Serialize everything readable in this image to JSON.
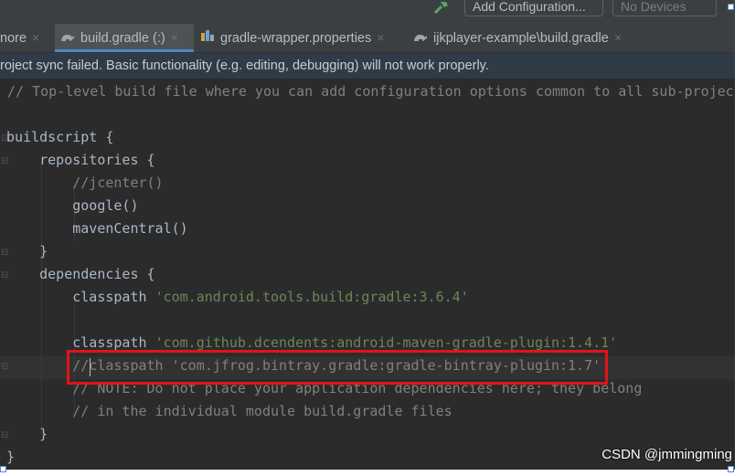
{
  "toolbar": {
    "config_label": "Add Configuration...",
    "devices_label": "No Devices"
  },
  "tabs": [
    {
      "label": "nore",
      "close": "×",
      "active": false
    },
    {
      "label": "build.gradle (:)",
      "close": "×",
      "active": true,
      "icon": "gradle-icon"
    },
    {
      "label": "gradle-wrapper.properties",
      "close": "×",
      "active": false,
      "icon": "properties-icon"
    },
    {
      "label": "ijkplayer-example\\build.gradle",
      "close": "×",
      "active": false,
      "icon": "gradle-icon"
    }
  ],
  "banner": {
    "message": "roject sync failed. Basic functionality (e.g. editing, debugging) will not work properly."
  },
  "code": {
    "line1": "// Top-level build file where you can add configuration options common to all sub-projec",
    "line3": "buildscript {",
    "line4": "    repositories {",
    "line5": "        //jcenter()",
    "line6": "        google()",
    "line7": "        mavenCentral()",
    "line8": "    }",
    "line9": "    dependencies {",
    "line10_kw": "        classpath ",
    "line10_str": "'com.android.tools.build:gradle:3.6.4'",
    "line12_kw": "        classpath ",
    "line12_str": "'com.github.dcendents:android-maven-gradle-plugin:1.4.1'",
    "line13": "        //classpath 'com.jfrog.bintray.gradle:gradle-bintray-plugin:1.7'",
    "line14": "        // NOTE: Do not place your application dependencies here; they belong",
    "line15": "        // in the individual module build.gradle files",
    "line16": "    }",
    "line17": "}"
  },
  "watermark": "CSDN @jmmingming",
  "colors": {
    "editor_bg": "#2b2b2b",
    "comment": "#808080",
    "string": "#6a8759",
    "highlight_box": "#e2131b"
  }
}
